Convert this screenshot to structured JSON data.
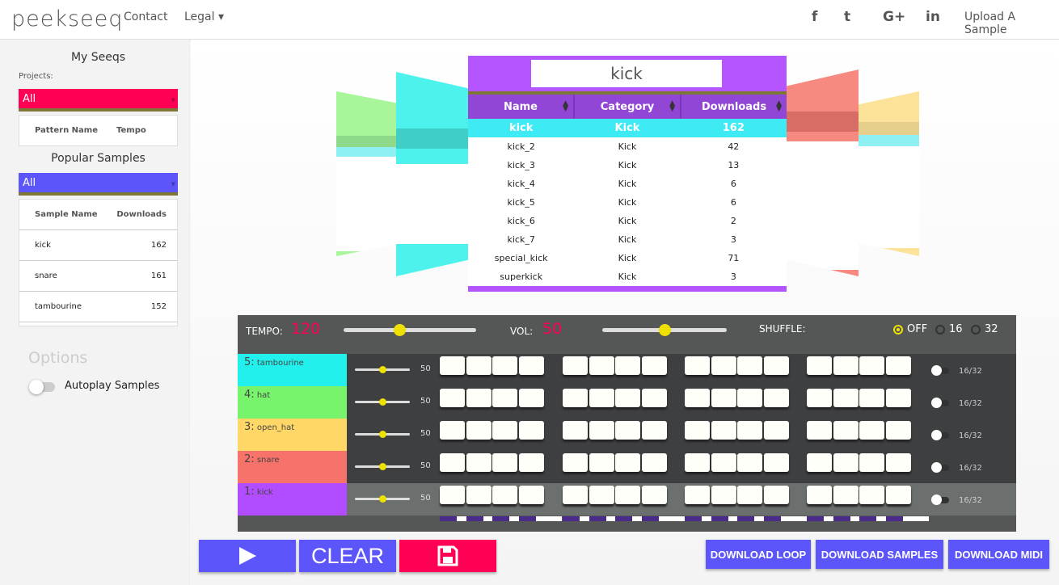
{
  "header": {
    "logo": "peekseeq",
    "nav": [
      {
        "label": "Contact"
      },
      {
        "label": "Legal ▾"
      }
    ],
    "social": [
      "f",
      "t",
      "G+",
      "in"
    ],
    "upload": "Upload A Sample"
  },
  "sidebar": {
    "my_seeqs": "My Seeqs",
    "projects_label": "Projects:",
    "projects_select": "All",
    "projects_cols": [
      "Pattern Name",
      "Tempo"
    ],
    "popular": "Popular Samples",
    "popular_select": "All",
    "popular_cols": [
      "Sample Name",
      "Downloads"
    ],
    "popular_rows": [
      {
        "name": "kick",
        "downloads": "162"
      },
      {
        "name": "snare",
        "downloads": "161"
      },
      {
        "name": "tambourine",
        "downloads": "152"
      }
    ],
    "options": "Options",
    "autoplay": "Autoplay Samples",
    "autoplay_on": false
  },
  "library": {
    "search_value": "kick",
    "columns": [
      "Name",
      "Category",
      "Downloads"
    ],
    "rows": [
      [
        "kick",
        "Kick",
        "162"
      ],
      [
        "kick_2",
        "Kick",
        "42"
      ],
      [
        "kick_3",
        "Kick",
        "13"
      ],
      [
        "kick_4",
        "Kick",
        "6"
      ],
      [
        "kick_5",
        "Kick",
        "6"
      ],
      [
        "kick_6",
        "Kick",
        "2"
      ],
      [
        "kick_7",
        "Kick",
        "3"
      ],
      [
        "special_kick",
        "Kick",
        "71"
      ],
      [
        "superkick",
        "Kick",
        "3"
      ]
    ],
    "highlight_row": 0,
    "colors": {
      "card": "#b455ff",
      "header": "#9146d6",
      "highlight": "#3eeaf4"
    }
  },
  "sequencer": {
    "tempo_label": "TEMPO:",
    "tempo": "120",
    "tempo_fraction": 0.42,
    "vol_label": "VOL:",
    "vol": "50",
    "vol_fraction": 0.5,
    "shuffle_label": "SHUFFLE:",
    "shuffle_options": [
      "OFF",
      "16",
      "32"
    ],
    "shuffle_selected": "OFF",
    "tracks": [
      {
        "num": "5:",
        "name": "tambourine",
        "vol": "50",
        "color": "#22f0ec"
      },
      {
        "num": "4:",
        "name": "hat",
        "vol": "50",
        "color": "#78f46c"
      },
      {
        "num": "3:",
        "name": "open_hat",
        "vol": "50",
        "color": "#ffd766"
      },
      {
        "num": "2:",
        "name": "snare",
        "vol": "50",
        "color": "#f7726a"
      },
      {
        "num": "1:",
        "name": "kick",
        "vol": "50",
        "color": "#b14cff"
      }
    ],
    "active_track": 4,
    "toggle_label": "16/32",
    "steps": 16
  },
  "controls": {
    "play": "play-icon",
    "clear": "CLEAR",
    "save": "save-icon",
    "download_loop": "DOWNLOAD LOOP",
    "download_samples": "DOWNLOAD SAMPLES",
    "download_midi": "DOWNLOAD MIDI"
  }
}
